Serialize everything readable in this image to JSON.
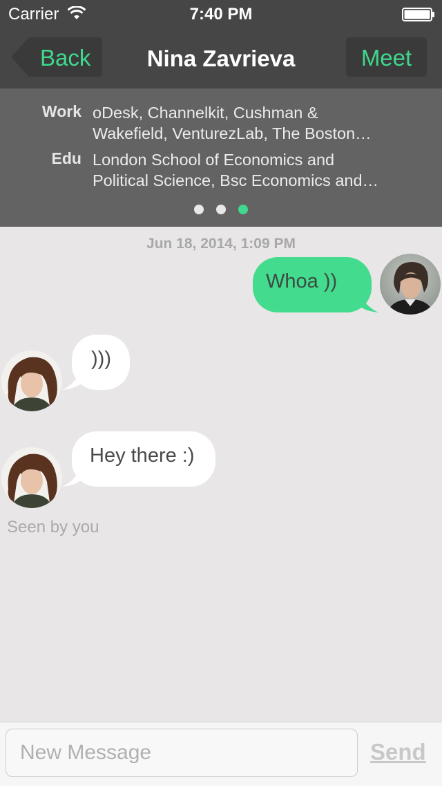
{
  "status_bar": {
    "carrier": "Carrier",
    "time": "7:40 PM"
  },
  "nav": {
    "back_label": "Back",
    "title": "Nina Zavrieva",
    "meet_label": "Meet",
    "accent_color": "#3fd88e"
  },
  "profile": {
    "work_key": "Work",
    "work_value_line1": "oDesk, Channelkit, Cushman &",
    "work_value_line2": "Wakefield, VenturezLab, The Boston…",
    "edu_key": "Edu",
    "edu_value_line1": "London School of Economics and",
    "edu_value_line2": "Political Science, Bsc Economics and…",
    "page_dots": 3,
    "active_dot": 3
  },
  "chat": {
    "timestamp": "Jun 18, 2014, 1:09 PM",
    "messages": [
      {
        "direction": "outgoing",
        "text": "Whoa ))"
      },
      {
        "direction": "incoming",
        "text": ")))"
      },
      {
        "direction": "incoming",
        "text": "Hey there :)"
      }
    ],
    "seen_label": "Seen by you"
  },
  "composer": {
    "placeholder": "New Message",
    "send_label": "Send"
  }
}
